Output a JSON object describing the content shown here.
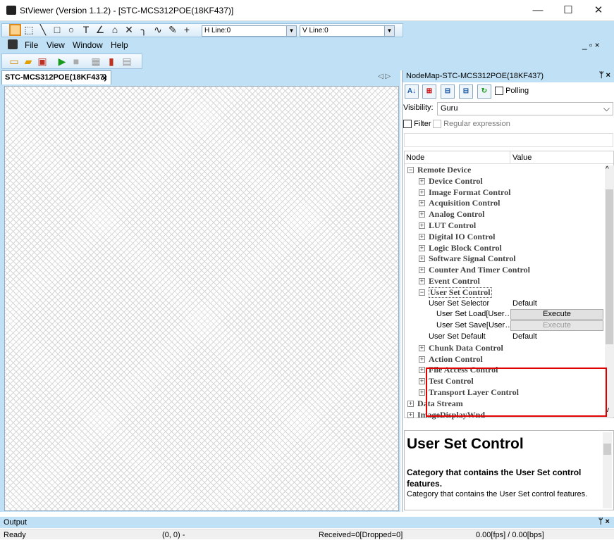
{
  "window": {
    "title": "StViewer (Version 1.1.2) - [STC-MCS312POE(18KF437)]",
    "minimize": "—",
    "maximize": "☐",
    "close": "✕"
  },
  "drawtools": {
    "hline_label": "H Line:0",
    "vline_label": "V Line:0"
  },
  "menu": {
    "items": [
      "File",
      "View",
      "Window",
      "Help"
    ],
    "right_controls": "_ ▫ ×"
  },
  "document": {
    "tab_label": "STC-MCS312POE(18KF437)",
    "tab_close": "×",
    "nav": "◁ ▷"
  },
  "nodemap": {
    "header": "NodeMap-STC-MCS312POE(18KF437)",
    "header_buttons": "ᛘ ×",
    "polling_label": "Polling",
    "visibility_label": "Visibility:",
    "visibility_value": "Guru",
    "filter_label": "Filter",
    "regex_label": "Regular expression",
    "col_node": "Node",
    "col_value": "Value",
    "tree": [
      {
        "label": "Remote Device",
        "level": 0,
        "type": "cat",
        "exp": "−"
      },
      {
        "label": "Device Control",
        "level": 1,
        "type": "cat",
        "exp": "+"
      },
      {
        "label": "Image Format Control",
        "level": 1,
        "type": "cat",
        "exp": "+"
      },
      {
        "label": "Acquisition Control",
        "level": 1,
        "type": "cat",
        "exp": "+"
      },
      {
        "label": "Analog Control",
        "level": 1,
        "type": "cat",
        "exp": "+"
      },
      {
        "label": "LUT Control",
        "level": 1,
        "type": "cat",
        "exp": "+"
      },
      {
        "label": "Digital IO Control",
        "level": 1,
        "type": "cat",
        "exp": "+"
      },
      {
        "label": "Logic Block Control",
        "level": 1,
        "type": "cat",
        "exp": "+"
      },
      {
        "label": "Software Signal Control",
        "level": 1,
        "type": "cat",
        "exp": "+"
      },
      {
        "label": "Counter And Timer Control",
        "level": 1,
        "type": "cat",
        "exp": "+"
      },
      {
        "label": "Event Control",
        "level": 1,
        "type": "cat",
        "exp": "+"
      },
      {
        "label": "User Set Control",
        "level": 1,
        "type": "cat",
        "exp": "−",
        "selected": true
      },
      {
        "label": "User Set Selector",
        "level": 2,
        "type": "feat",
        "value": "Default"
      },
      {
        "label": "User Set Load[User…",
        "level": 3,
        "type": "feat",
        "button": "Execute",
        "disabled": false
      },
      {
        "label": "User Set Save[User…",
        "level": 3,
        "type": "feat",
        "button": "Execute",
        "disabled": true
      },
      {
        "label": "User Set Default",
        "level": 2,
        "type": "feat",
        "value": "Default"
      },
      {
        "label": "Chunk Data Control",
        "level": 1,
        "type": "cat",
        "exp": "+"
      },
      {
        "label": "Action Control",
        "level": 1,
        "type": "cat",
        "exp": "+"
      },
      {
        "label": "File Access Control",
        "level": 1,
        "type": "cat",
        "exp": "+"
      },
      {
        "label": "Test Control",
        "level": 1,
        "type": "cat",
        "exp": "+"
      },
      {
        "label": "Transport Layer Control",
        "level": 1,
        "type": "cat",
        "exp": "+"
      },
      {
        "label": "Data Stream",
        "level": 0,
        "type": "cat",
        "exp": "+"
      },
      {
        "label": "ImageDisplayWnd",
        "level": 0,
        "type": "cat",
        "exp": "+"
      }
    ],
    "description": {
      "heading": "User Set Control",
      "bold": "Category that contains the User Set control features.",
      "normal": "Category that contains the User Set control features."
    }
  },
  "output": {
    "label": "Output",
    "buttons": "ᛘ ×"
  },
  "status": {
    "ready": "Ready",
    "coords": "(0, 0) -",
    "received": "Received=0[Dropped=0]",
    "fps": "0.00[fps] / 0.00[bps]"
  }
}
